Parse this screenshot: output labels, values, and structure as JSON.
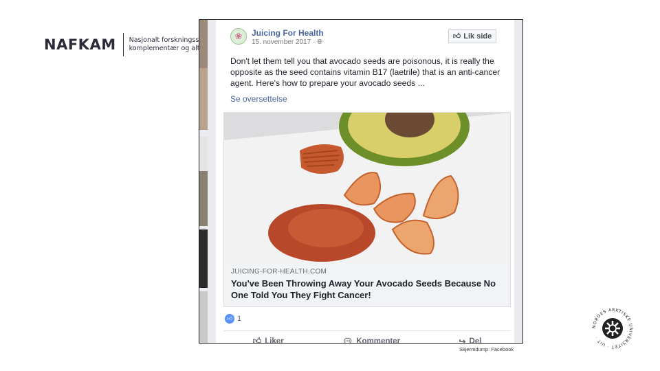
{
  "logo": {
    "wordmark": "NAFKAM",
    "subtitle_line1": "Nasjonalt forskningssenter innen",
    "subtitle_line2": "komplementær og alternativ medisin"
  },
  "post": {
    "page_name": "Juicing For Health",
    "date": "15. november 2017 · ",
    "privacy_icon": "globe-icon",
    "like_page_label": "Lik side",
    "text": "Don't let them tell you that avocado seeds are poisonous, it is really the opposite as the seed contains vitamin B17 (laetrile) that is an anti-cancer agent. Here's how to prepare your avocado seeds ...",
    "see_translation": "Se oversettelse",
    "link": {
      "domain": "JUICING-FOR-HEALTH.COM",
      "title": "You've Been Throwing Away Your Avocado Seeds Because No One Told You They Fight Cancer!"
    },
    "reaction_count": "1",
    "actions": {
      "like": "Liker",
      "comment": "Kommenter",
      "share": "Del"
    }
  },
  "caption": "Skjermdump: Facebook",
  "seal_text": "NORGES ARKTISKE UNIVERSITET · UiT",
  "colors": {
    "facebook_link": "#4a66a0",
    "like_blue": "#5890ff"
  }
}
